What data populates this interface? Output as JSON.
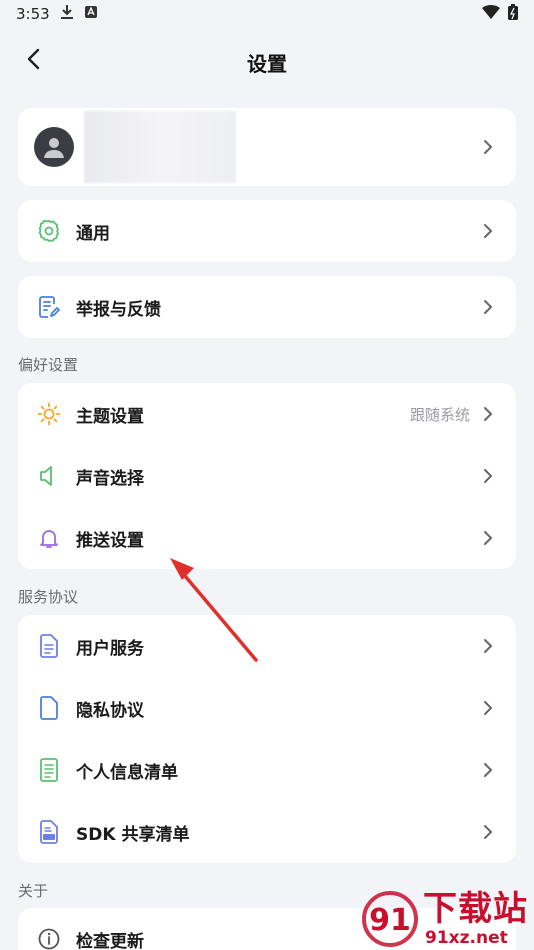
{
  "status_bar": {
    "time": "3:53"
  },
  "header": {
    "title": "设置"
  },
  "general": {
    "label": "通用"
  },
  "feedback": {
    "label": "举报与反馈"
  },
  "preferences": {
    "section_title": "偏好设置",
    "items": [
      {
        "label": "主题设置",
        "value": "跟随系统"
      },
      {
        "label": "声音选择"
      },
      {
        "label": "推送设置"
      }
    ]
  },
  "services": {
    "section_title": "服务协议",
    "items": [
      {
        "label": "用户服务"
      },
      {
        "label": "隐私协议"
      },
      {
        "label": "个人信息清单"
      },
      {
        "label": "SDK 共享清单"
      }
    ]
  },
  "about": {
    "section_title": "关于",
    "items": [
      {
        "label": "检查更新"
      }
    ]
  },
  "watermark": {
    "big": "下载站",
    "small": "91xz.net",
    "logo_digits": "91"
  },
  "colors": {
    "background": "#f3f4f8",
    "card": "#ffffff",
    "gear_icon": "#5bbf74",
    "doc_icon": "#4a7fe0",
    "sun_icon": "#f2a92b",
    "speaker_icon": "#5bbf74",
    "bell_icon": "#9b6be0",
    "file_icon": "#6c7fe6",
    "annotation_arrow": "#e0302c",
    "watermark": "#c8102e"
  }
}
